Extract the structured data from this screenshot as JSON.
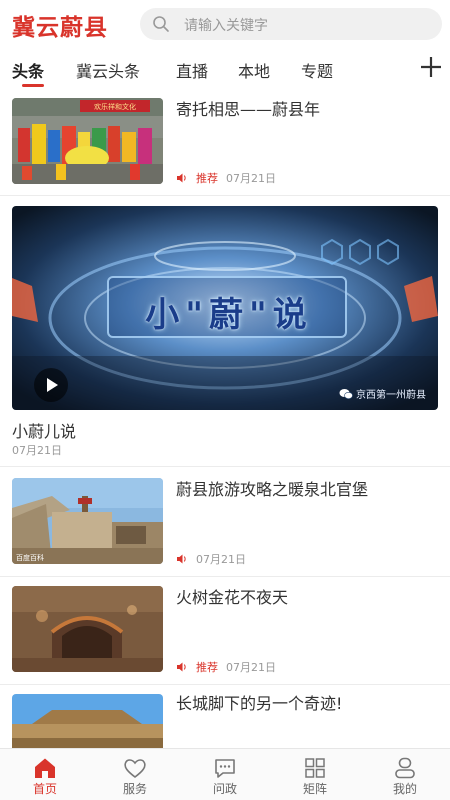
{
  "app": {
    "logo_text": "冀云蔚县",
    "accent_color": "#d9342b"
  },
  "search": {
    "placeholder": "请输入关键字"
  },
  "tabs": [
    {
      "label": "头条",
      "active": true
    },
    {
      "label": "冀云头条",
      "active": false
    },
    {
      "label": "直播",
      "active": false
    },
    {
      "label": "本地",
      "active": false
    },
    {
      "label": "专题",
      "active": false
    }
  ],
  "feed": [
    {
      "type": "article",
      "title": "寄托相思——蔚县年",
      "tag": "推荐",
      "date": "07月21日",
      "thumb_banner": "欢乐祥和文化"
    },
    {
      "type": "video",
      "video_title": "小\"蔚\"说",
      "watermark": "京西第一州蔚县",
      "caption": "小蔚儿说",
      "date": "07月21日"
    },
    {
      "type": "article",
      "title": "蔚县旅游攻略之暖泉北官堡",
      "tag": "",
      "date": "07月21日",
      "thumb_credit": "百度百科"
    },
    {
      "type": "article",
      "title": "火树金花不夜天",
      "tag": "推荐",
      "date": "07月21日"
    },
    {
      "type": "article",
      "title": "长城脚下的另一个奇迹!",
      "tag": "",
      "date": ""
    }
  ],
  "bottom_nav": [
    {
      "label": "首页",
      "icon": "home-icon",
      "active": true
    },
    {
      "label": "服务",
      "icon": "heart-icon",
      "active": false
    },
    {
      "label": "问政",
      "icon": "chat-icon",
      "active": false
    },
    {
      "label": "矩阵",
      "icon": "grid-icon",
      "active": false
    },
    {
      "label": "我的",
      "icon": "user-icon",
      "active": false
    }
  ]
}
